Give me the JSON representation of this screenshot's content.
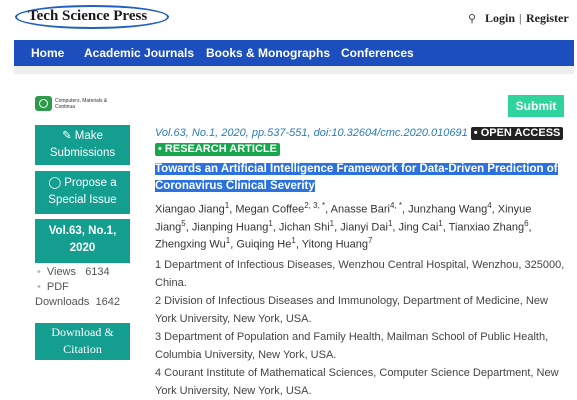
{
  "header": {
    "logo": "Tech Science Press",
    "search_icon": "⚲",
    "login": "Login",
    "separator": "|",
    "register": "Register"
  },
  "nav": [
    "Home",
    "Academic Journals",
    "Books & Monographs",
    "Conferences"
  ],
  "journal_logo": "Computers, Materials & Continua",
  "submit": "Submit",
  "sidebar": {
    "make_submissions": "Make Submissions",
    "propose_special_issue": "Propose a Special Issue",
    "volume": "Vol.63, No.1, 2020",
    "views_label": "Views",
    "views_value": "6134",
    "pdf_label": "PDF",
    "downloads_label": "Downloads",
    "downloads_value": "1642",
    "download_citation": "Download & Citation"
  },
  "article": {
    "citation": "Vol.63, No.1, 2020, pp.537-551, doi:10.32604/cmc.2020.010691",
    "open_access": "• OPEN ACCESS",
    "research_article": "• RESEARCH ARTICLE",
    "title": "Towards an Artificial Intelligence Framework for Data-Driven Prediction of Coronavirus Clinical Severity",
    "authors": [
      {
        "name": "Xiangao Jiang",
        "sup": "1"
      },
      {
        "name": "Megan Coffee",
        "sup": "2, 3, *"
      },
      {
        "name": "Anasse Bari",
        "sup": "4, *"
      },
      {
        "name": "Junzhang Wang",
        "sup": "4"
      },
      {
        "name": "Xinyue Jiang",
        "sup": "5"
      },
      {
        "name": "Jianping Huang",
        "sup": "1"
      },
      {
        "name": "Jichan Shi",
        "sup": "1"
      },
      {
        "name": "Jianyi Dai",
        "sup": "1"
      },
      {
        "name": "Jing Cai",
        "sup": "1"
      },
      {
        "name": "Tianxiao Zhang",
        "sup": "6"
      },
      {
        "name": "Zhengxing Wu",
        "sup": "1"
      },
      {
        "name": "Guiqing He",
        "sup": "1"
      },
      {
        "name": "Yitong Huang",
        "sup": "7"
      }
    ],
    "affiliations": [
      "1 Department of Infectious Diseases, Wenzhou Central Hospital, Wenzhou, 325000, China.",
      "2 Division of Infectious Diseases and Immunology, Department of Medicine, New York University, New York, USA.",
      "3 Department of Population and Family Health, Mailman School of Public Health, Columbia University, New York, USA.",
      "4 Courant Institute of Mathematical Sciences, Computer Science Department, New York University, New York, USA."
    ]
  }
}
